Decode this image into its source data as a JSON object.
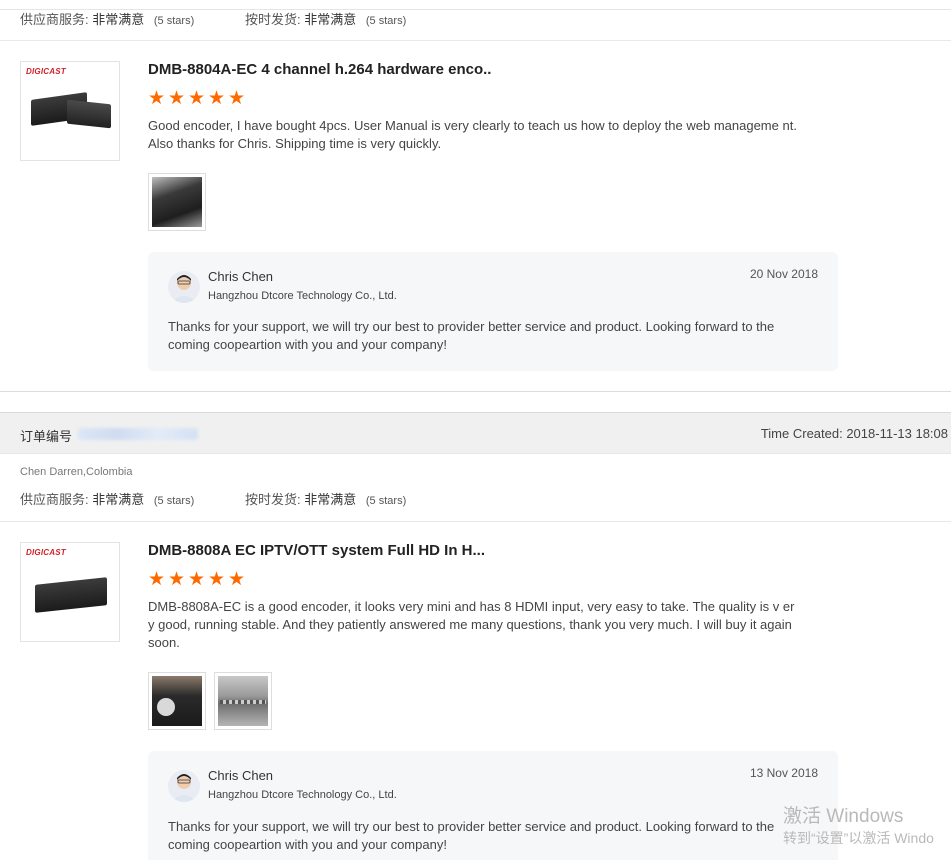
{
  "ratings_labels": {
    "supplier_service": "供应商服务:",
    "on_time": "按时发货:",
    "very_satisfied": "非常满意",
    "five_stars": "(5 stars)"
  },
  "reviews": [
    {
      "product_brand": "DIGICAST",
      "product_title": "DMB-8804A-EC 4 channel h.264 hardware enco..",
      "star_count": 5,
      "review_text": "Good encoder, I have bought 4pcs. User Manual is very clearly to teach us how to deploy the web manageme nt. Also thanks for Chris. Shipping time is very quickly.",
      "reply": {
        "name": "Chris Chen",
        "company": "Hangzhou Dtcore Technology Co., Ltd.",
        "date": "20 Nov 2018",
        "text": "Thanks for your support, we will try our best to provider better service and product. Looking forward to the coming coopeartion with you and your company!"
      }
    },
    {
      "order_label": "订单编号",
      "time_created": "Time Created: 2018-11-13 18:08",
      "buyer": "Chen Darren,Colombia",
      "product_brand": "DIGICAST",
      "product_title": "DMB-8808A EC IPTV/OTT system Full HD In H...",
      "star_count": 5,
      "review_text": "DMB-8808A-EC is a good encoder, it looks very mini and has 8 HDMI input, very easy to take. The quality is v ery good, running stable. And they patiently answered me many questions, thank you very much. I will buy it again soon.",
      "reply": {
        "name": "Chris Chen",
        "company": "Hangzhou Dtcore Technology Co., Ltd.",
        "date": "13 Nov 2018",
        "text": "Thanks for your support, we will try our best to provider better service and product. Looking forward to the coming coopeartion with you and your company!"
      }
    }
  ],
  "watermark": {
    "line1": "激活 Windows",
    "line2": "转到“设置”以激活 Windo"
  },
  "colors": {
    "star": "#ff6a00",
    "brand": "#d3202a",
    "reply_bg": "#f6f7f9"
  }
}
